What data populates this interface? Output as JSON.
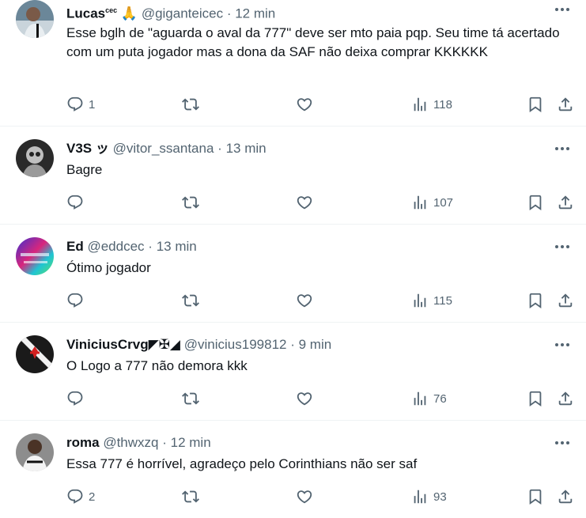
{
  "tweets": [
    {
      "name": "Lucas",
      "name_sup": "cec",
      "name_emoji": "🙏",
      "handle": "@giganteicec",
      "dot": "·",
      "time": "12 min",
      "text": "Esse bglh de \"aguarda o aval da 777\" deve ser mto paia pqp. Seu time tá acertado com um puta jogador mas a dona da SAF não deixa comprar KKKKKK",
      "replies": "1",
      "retweets": "",
      "likes": "",
      "views": "118"
    },
    {
      "name": "V3S ッ",
      "handle": "@vitor_ssantana",
      "dot": "·",
      "time": "13 min",
      "text": "Bagre",
      "replies": "",
      "retweets": "",
      "likes": "",
      "views": "107"
    },
    {
      "name": "Ed",
      "handle": "@eddcec",
      "dot": "·",
      "time": "13 min",
      "text": "Ótimo jogador",
      "replies": "",
      "retweets": "",
      "likes": "",
      "views": "115"
    },
    {
      "name": "ViniciusCrvg◤✠◢",
      "handle": "@vinicius199812",
      "dot": "·",
      "time": "9 min",
      "text": "O Logo a 777 não demora kkk",
      "replies": "",
      "retweets": "",
      "likes": "",
      "views": "76"
    },
    {
      "name": "roma",
      "handle": "@thwxzq",
      "dot": "·",
      "time": "12 min",
      "text": "Essa 777 é horrível, agradeço pelo Corinthians não ser saf",
      "replies": "2",
      "retweets": "",
      "likes": "",
      "views": "93"
    }
  ],
  "colors": {
    "text": "#0f1419",
    "secondary": "#536471",
    "divider": "#eff3f4"
  }
}
